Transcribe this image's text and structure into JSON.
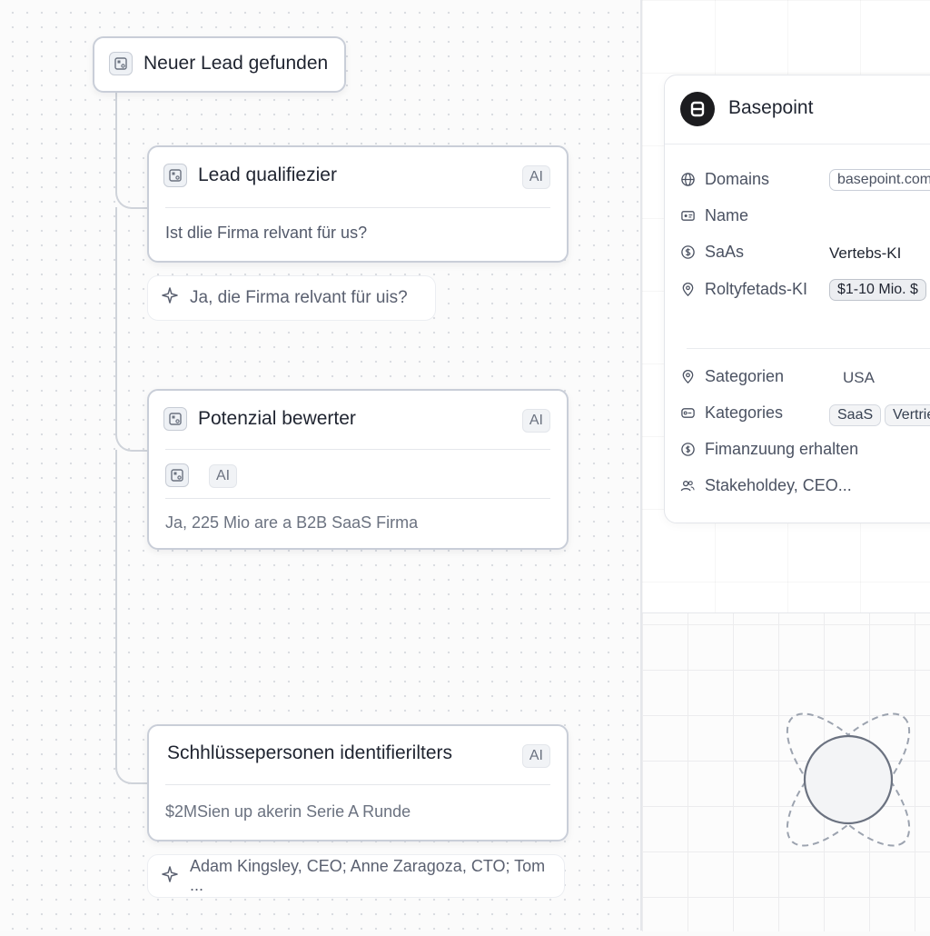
{
  "canvas": {
    "trigger": {
      "label": "Neuer Lead gefunden",
      "icon": "node-icon"
    },
    "qualify": {
      "title": "Lead qualifiezier",
      "badge": "AI",
      "question": "Ist dlie Firma relvant für us?",
      "answer": "Ja, die Firma relvant für uis?"
    },
    "potential": {
      "title": "Potenzial bewerter",
      "badge": "AI",
      "inner_badge": "AI",
      "result": "Ja, 225 Mio are a B2B SaaS Firma"
    },
    "stakeholders": {
      "title": "Schhlüssepersonen identifierilters",
      "badge": "AI",
      "result": "$2MSien up akerin Serie A Runde",
      "answer": "Adam Kingsley, CEO; Anne Zaragoza, CTO; Tom ..."
    }
  },
  "company": {
    "name": "Basepoint",
    "fields": [
      {
        "icon": "globe-icon",
        "label": "Domains"
      },
      {
        "icon": "id-card-icon",
        "label": "Name"
      },
      {
        "icon": "dollar-icon",
        "label": "SaAs"
      },
      {
        "icon": "location-pin-icon",
        "label": "Roltyfetads-KI"
      },
      {
        "icon": "location-pin-icon",
        "label": "Sategorien"
      },
      {
        "icon": "tag-icon",
        "label": "Kategories"
      },
      {
        "icon": "coin-icon",
        "label": "Fimanzuung erhalten"
      },
      {
        "icon": "users-icon",
        "label": "Stakeholdey, CEO..."
      }
    ],
    "values": {
      "domain": "basepoint.com",
      "saas": "Vertebs-KI",
      "revenue": "$1-10 Mio. $",
      "country": "USA",
      "tag1": "SaaS",
      "tag2": "Vertrieb"
    }
  },
  "colors": {
    "accent": "#1c1c1f",
    "border": "#c9ced8",
    "muted": "#6b7280"
  }
}
